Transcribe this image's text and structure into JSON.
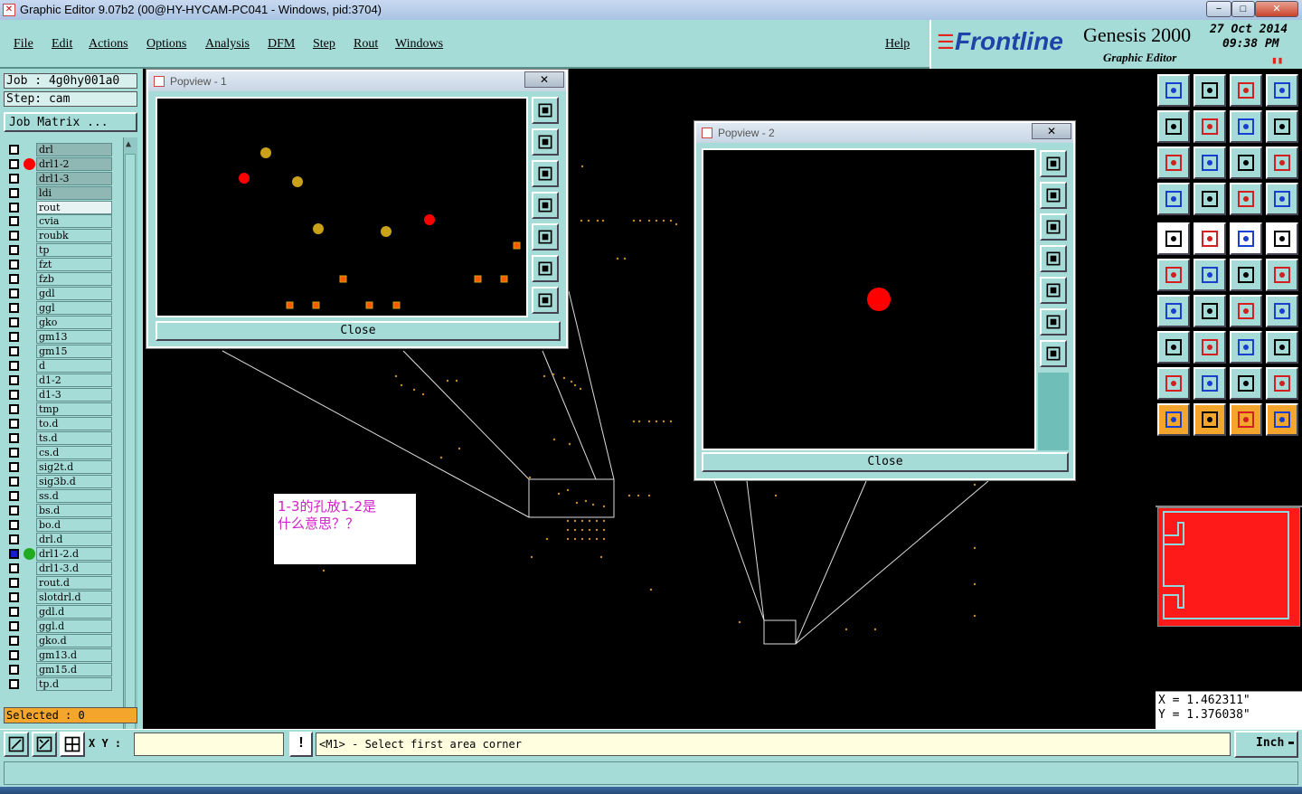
{
  "window": {
    "title": "Graphic Editor 9.07b2 (00@HY-HYCAM-PC041 - Windows, pid:3704)"
  },
  "menu": {
    "file": "File",
    "edit": "Edit",
    "actions": "Actions",
    "options": "Options",
    "analysis": "Analysis",
    "dfm": "DFM",
    "step": "Step",
    "rout": "Rout",
    "windows": "Windows",
    "help": "Help"
  },
  "brand": {
    "logo": "Frontline",
    "product": "Genesis 2000",
    "subtitle": "Graphic Editor",
    "date": "27 Oct 2014",
    "time": "09:38 PM"
  },
  "job": {
    "job_label": "Job : 4g0hy001a0",
    "step_label": "Step: cam",
    "matrix_button": "Job Matrix ..."
  },
  "layers": {
    "group1": [
      "drl",
      "drl1-2",
      "drl1-3",
      "ldi",
      "rout"
    ],
    "group2": [
      "cvia",
      "roubk",
      "tp",
      "fzt",
      "fzb",
      "gdl",
      "ggl",
      "gko",
      "gm13",
      "gm15",
      "d",
      "d1-2",
      "d1-3",
      "tmp",
      "to.d",
      "ts.d",
      "cs.d",
      "sig2t.d",
      "sig3b.d",
      "ss.d",
      "bs.d",
      "bo.d",
      "drl.d",
      "drl1-2.d",
      "drl1-3.d",
      "rout.d",
      "slotdrl.d",
      "gdl.d",
      "ggl.d",
      "gko.d",
      "gm13.d",
      "gm15.d",
      "tp.d"
    ]
  },
  "selected": "Selected : 0",
  "popview1": {
    "title": "Popview - 1",
    "close_label": "Close"
  },
  "popview2": {
    "title": "Popview - 2",
    "close_label": "Close"
  },
  "note": {
    "line1": "1-3的孔放1-2是",
    "line2": "什么意思？？"
  },
  "coords": {
    "x": "X = 1.462311\"",
    "y": "Y = 1.376038\""
  },
  "status": {
    "xy_label": "X Y :",
    "xy_value": "",
    "message": "<M1> - Select first area corner",
    "units": "Inch"
  },
  "colors": {
    "panel": "#a6dcd8",
    "pad_red": "#ff0000",
    "pad_gold": "#c9a21a",
    "accent_orange": "#f3a52c"
  }
}
